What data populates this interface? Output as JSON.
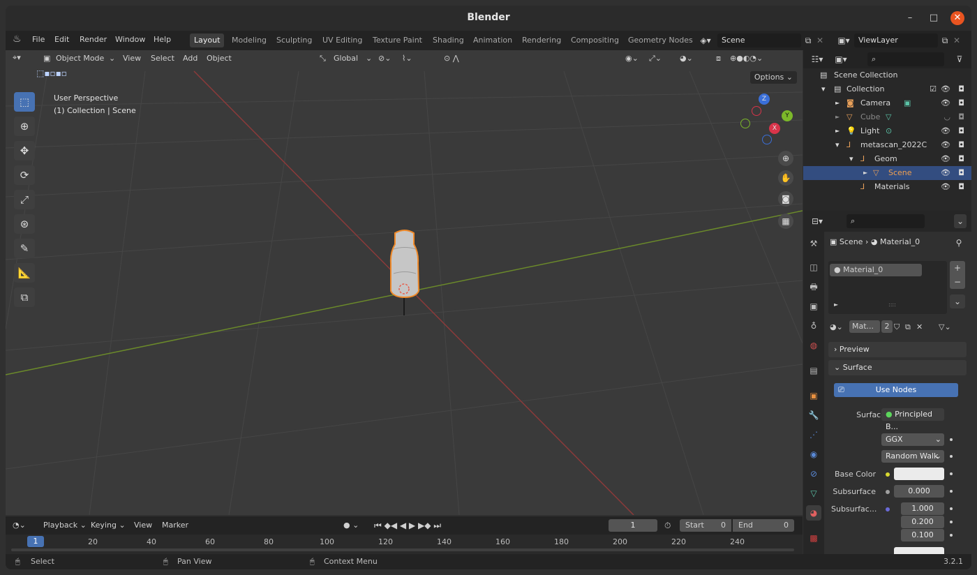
{
  "window": {
    "title": "Blender",
    "minimize": "–",
    "maximize": "□",
    "close": "✕"
  },
  "menu": {
    "items": [
      "File",
      "Edit",
      "Render",
      "Window",
      "Help"
    ],
    "workspaces": [
      "Layout",
      "Modeling",
      "Sculpting",
      "UV Editing",
      "Texture Paint",
      "Shading",
      "Animation",
      "Rendering",
      "Compositing",
      "Geometry Nodes"
    ],
    "active_workspace": "Layout",
    "scene": "Scene",
    "view_layer": "ViewLayer"
  },
  "viewport": {
    "mode": "Object Mode",
    "menus": [
      "View",
      "Select",
      "Add",
      "Object"
    ],
    "transform_orientation": "Global",
    "options_label": "Options",
    "overlay_line1": "User Perspective",
    "overlay_line2": "(1) Collection | Scene",
    "gizmo": {
      "z": "Z",
      "y": "Y",
      "x": "X"
    }
  },
  "outliner": {
    "rows": [
      {
        "label": "Scene Collection",
        "indent": 0,
        "icon": "box"
      },
      {
        "label": "Collection",
        "indent": 1,
        "icon": "box"
      },
      {
        "label": "Camera",
        "indent": 2,
        "icon": "camera"
      },
      {
        "label": "Cube",
        "indent": 2,
        "icon": "mesh"
      },
      {
        "label": "Light",
        "indent": 2,
        "icon": "light"
      },
      {
        "label": "metascan_2022C",
        "indent": 2,
        "icon": "empty"
      },
      {
        "label": "Geom",
        "indent": 3,
        "icon": "empty"
      },
      {
        "label": "Scene",
        "indent": 4,
        "icon": "mesh"
      },
      {
        "label": "Materials",
        "indent": 3,
        "icon": "empty"
      }
    ]
  },
  "properties": {
    "breadcrumb_object": "Scene",
    "breadcrumb_material": "Material_0",
    "slot": "Material_0",
    "material_short": "Mat...",
    "users": "2",
    "preview_label": "Preview",
    "surface_label": "Surface",
    "use_nodes": "Use Nodes",
    "surface_shader_label": "Surface",
    "surface_shader": "Principled B...",
    "distribution": "GGX",
    "subsurface_method": "Random Walk",
    "base_color_label": "Base Color",
    "subsurface_label": "Subsurface",
    "subsurface_value": "0.000",
    "subsurface_radius_label": "Subsurfac...",
    "radius": [
      "1.000",
      "0.200",
      "0.100"
    ]
  },
  "timeline": {
    "menus": [
      "Playback",
      "Keying",
      "View",
      "Marker"
    ],
    "current_frame": "1",
    "start_label": "Start",
    "start_value": "0",
    "end_label": "End",
    "end_value": "0",
    "ticks": [
      "20",
      "40",
      "60",
      "80",
      "100",
      "120",
      "140",
      "160",
      "180",
      "200",
      "220",
      "240"
    ],
    "cursor_frame": "1"
  },
  "status": {
    "select": "Select",
    "pan": "Pan View",
    "context": "Context Menu",
    "version": "3.2.1"
  }
}
